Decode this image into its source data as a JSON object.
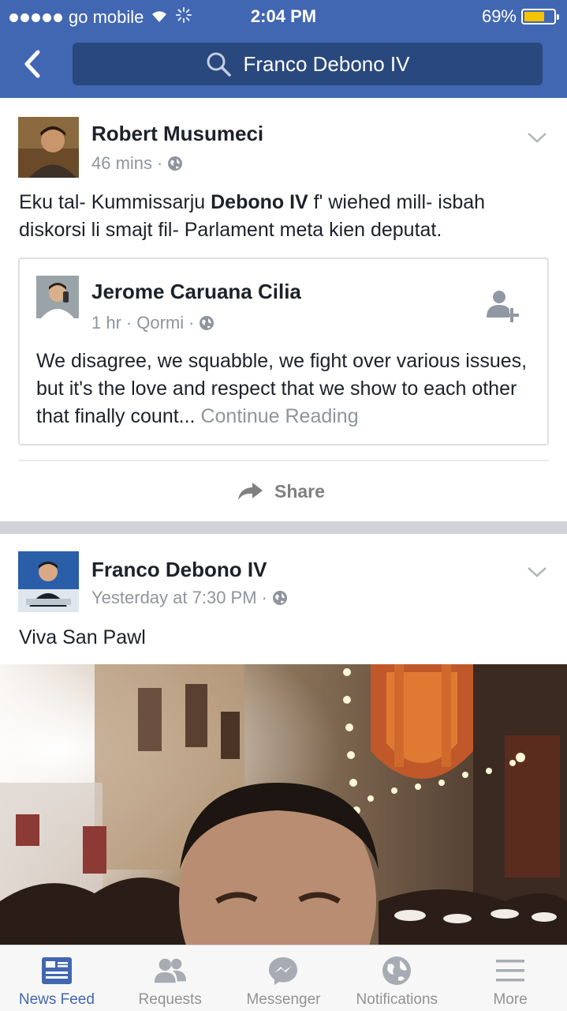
{
  "status_bar": {
    "carrier": "go mobile",
    "time": "2:04 PM",
    "battery_percent": "69%",
    "battery_level": 0.69,
    "signal_icon": "signal-dots-icon",
    "wifi_icon": "wifi-icon",
    "activity_icon": "loading-spinner-icon"
  },
  "header": {
    "back_icon": "back-arrow-icon",
    "search_icon": "search-icon",
    "search_text": "Franco Debono IV",
    "color": "#4267b2",
    "search_bg": "#29487d"
  },
  "posts": [
    {
      "author": "Robert Musumeci",
      "time": "46 mins",
      "separator": "·",
      "privacy_icon": "globe-icon",
      "text_parts": {
        "before": "Eku tal- Kummissarju ",
        "bold": "Debono IV",
        "after": " f' wiehed mill- isbah diskorsi li smajt fil- Parlament meta kien deputat."
      },
      "shared": {
        "author": "Jerome Caruana Cilia",
        "time": "1 hr",
        "location": "Qormi",
        "separator": "·",
        "add_friend_icon": "add-friend-icon",
        "text": "We disagree, we squabble, we fight over various issues, but it's the love and respect that we show to each other that finally count...",
        "continue_label": "Continue Reading"
      },
      "share_label": "Share",
      "share_icon": "share-arrow-icon"
    },
    {
      "author": "Franco Debono IV",
      "time": "Yesterday at 7:30 PM",
      "separator": "·",
      "privacy_icon": "globe-icon",
      "text": "Viva San Pawl"
    }
  ],
  "tabs": [
    {
      "label": "News Feed",
      "icon": "news-feed-icon",
      "active": true
    },
    {
      "label": "Requests",
      "icon": "friend-requests-icon",
      "active": false
    },
    {
      "label": "Messenger",
      "icon": "messenger-icon",
      "active": false
    },
    {
      "label": "Notifications",
      "icon": "notifications-globe-icon",
      "active": false
    },
    {
      "label": "More",
      "icon": "more-menu-icon",
      "active": false
    }
  ],
  "colors": {
    "accent": "#4267b2",
    "muted": "#90949c",
    "battery": "#f5c400"
  }
}
